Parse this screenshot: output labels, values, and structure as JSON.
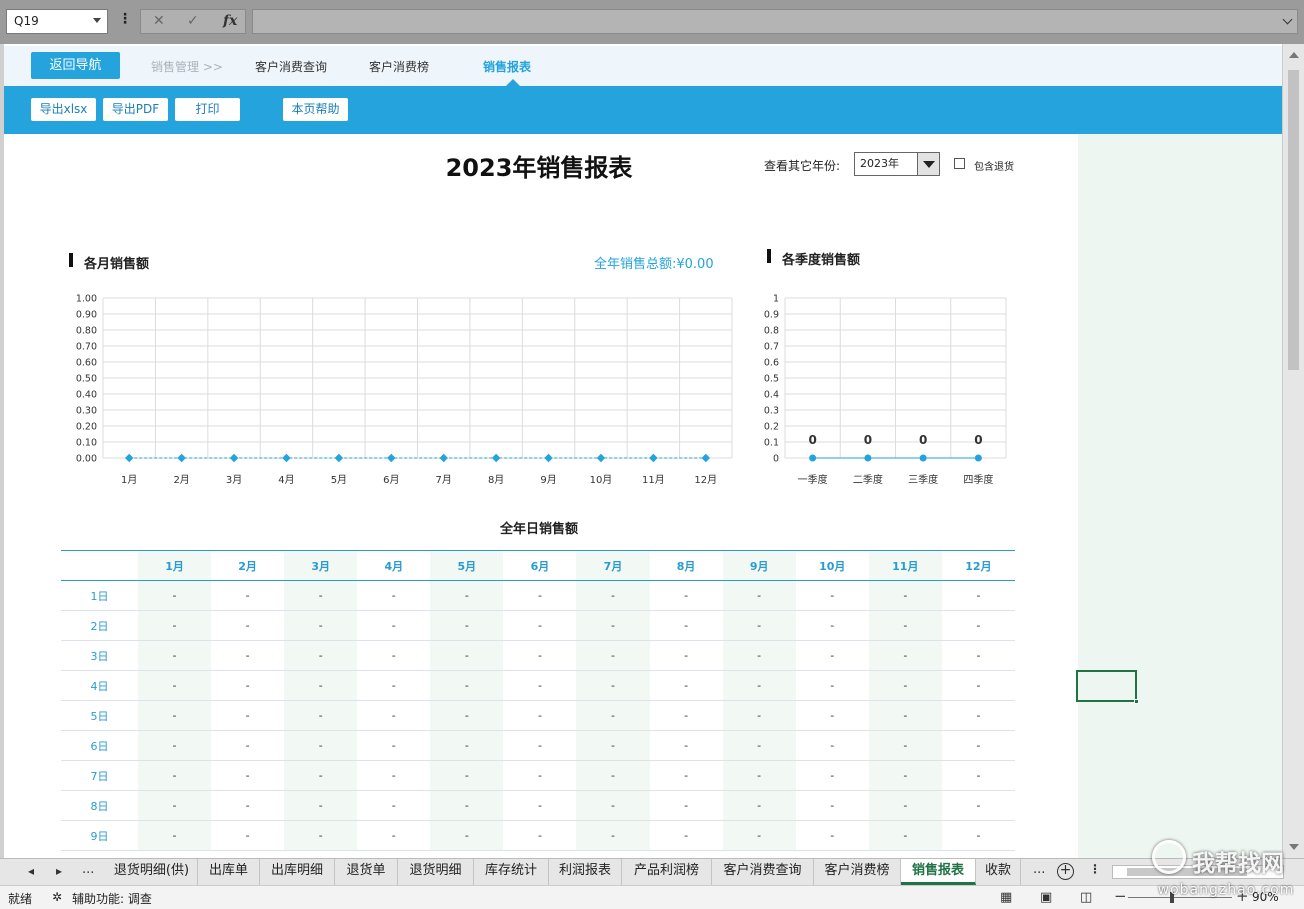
{
  "formula_bar": {
    "name_box": "Q19",
    "cancel_icon": "✕",
    "enter_icon": "✓",
    "fx_label": "fx"
  },
  "nav": {
    "back_label": "返回导航",
    "breadcrumb": "销售管理 >>",
    "items": [
      "客户消费查询",
      "客户消费榜",
      "销售报表"
    ],
    "active": "销售报表"
  },
  "toolbar": {
    "export_xlsx": "导出xlsx",
    "export_pdf": "导出PDF",
    "print": "打印",
    "help": "本页帮助"
  },
  "report": {
    "title": "2023年销售报表",
    "year_label": "查看其它年份:",
    "year_value": "2023年",
    "include_returns_label": "包含退货",
    "include_returns_checked": false
  },
  "monthly": {
    "title": "各月销售额",
    "total_label": "全年销售总额:¥0.00"
  },
  "quarterly": {
    "title": "各季度销售额"
  },
  "chart_data": [
    {
      "type": "line",
      "title": "各月销售额",
      "categories": [
        "1月",
        "2月",
        "3月",
        "4月",
        "5月",
        "6月",
        "7月",
        "8月",
        "9月",
        "10月",
        "11月",
        "12月"
      ],
      "values": [
        0,
        0,
        0,
        0,
        0,
        0,
        0,
        0,
        0,
        0,
        0,
        0
      ],
      "yticks": [
        "0.00",
        "0.10",
        "0.20",
        "0.30",
        "0.40",
        "0.50",
        "0.60",
        "0.70",
        "0.80",
        "0.90",
        "1.00"
      ],
      "ylim": [
        0,
        1
      ],
      "grid": true,
      "color": "#24a3dc"
    },
    {
      "type": "line",
      "title": "各季度销售额",
      "categories": [
        "一季度",
        "二季度",
        "三季度",
        "四季度"
      ],
      "values": [
        0,
        0,
        0,
        0
      ],
      "data_labels": [
        "0",
        "0",
        "0",
        "0"
      ],
      "yticks": [
        "0",
        "0.1",
        "0.2",
        "0.3",
        "0.4",
        "0.5",
        "0.6",
        "0.7",
        "0.8",
        "0.9",
        "1"
      ],
      "ylim": [
        0,
        1
      ],
      "grid": true,
      "color": "#24a3dc"
    }
  ],
  "daily": {
    "title": "全年日销售额",
    "months": [
      "1月",
      "2月",
      "3月",
      "4月",
      "5月",
      "6月",
      "7月",
      "8月",
      "9月",
      "10月",
      "11月",
      "12月"
    ],
    "days": [
      "1日",
      "2日",
      "3日",
      "4日",
      "5日",
      "6日",
      "7日",
      "8日",
      "9日"
    ],
    "empty_value": "-"
  },
  "sheet_tabs": {
    "tabs": [
      "退货明细(供)",
      "出库单",
      "出库明细",
      "退货单",
      "退货明细",
      "库存统计",
      "利润报表",
      "产品利润榜",
      "客户消费查询",
      "客户消费榜",
      "销售报表",
      "收款"
    ],
    "active": "销售报表",
    "more": "...",
    "add": "+"
  },
  "status": {
    "ready": "就绪",
    "accessibility": "辅助功能: 调查",
    "zoom": "90%"
  },
  "watermark": {
    "logo": "我帮找网",
    "url": "wobangzhao.com"
  }
}
